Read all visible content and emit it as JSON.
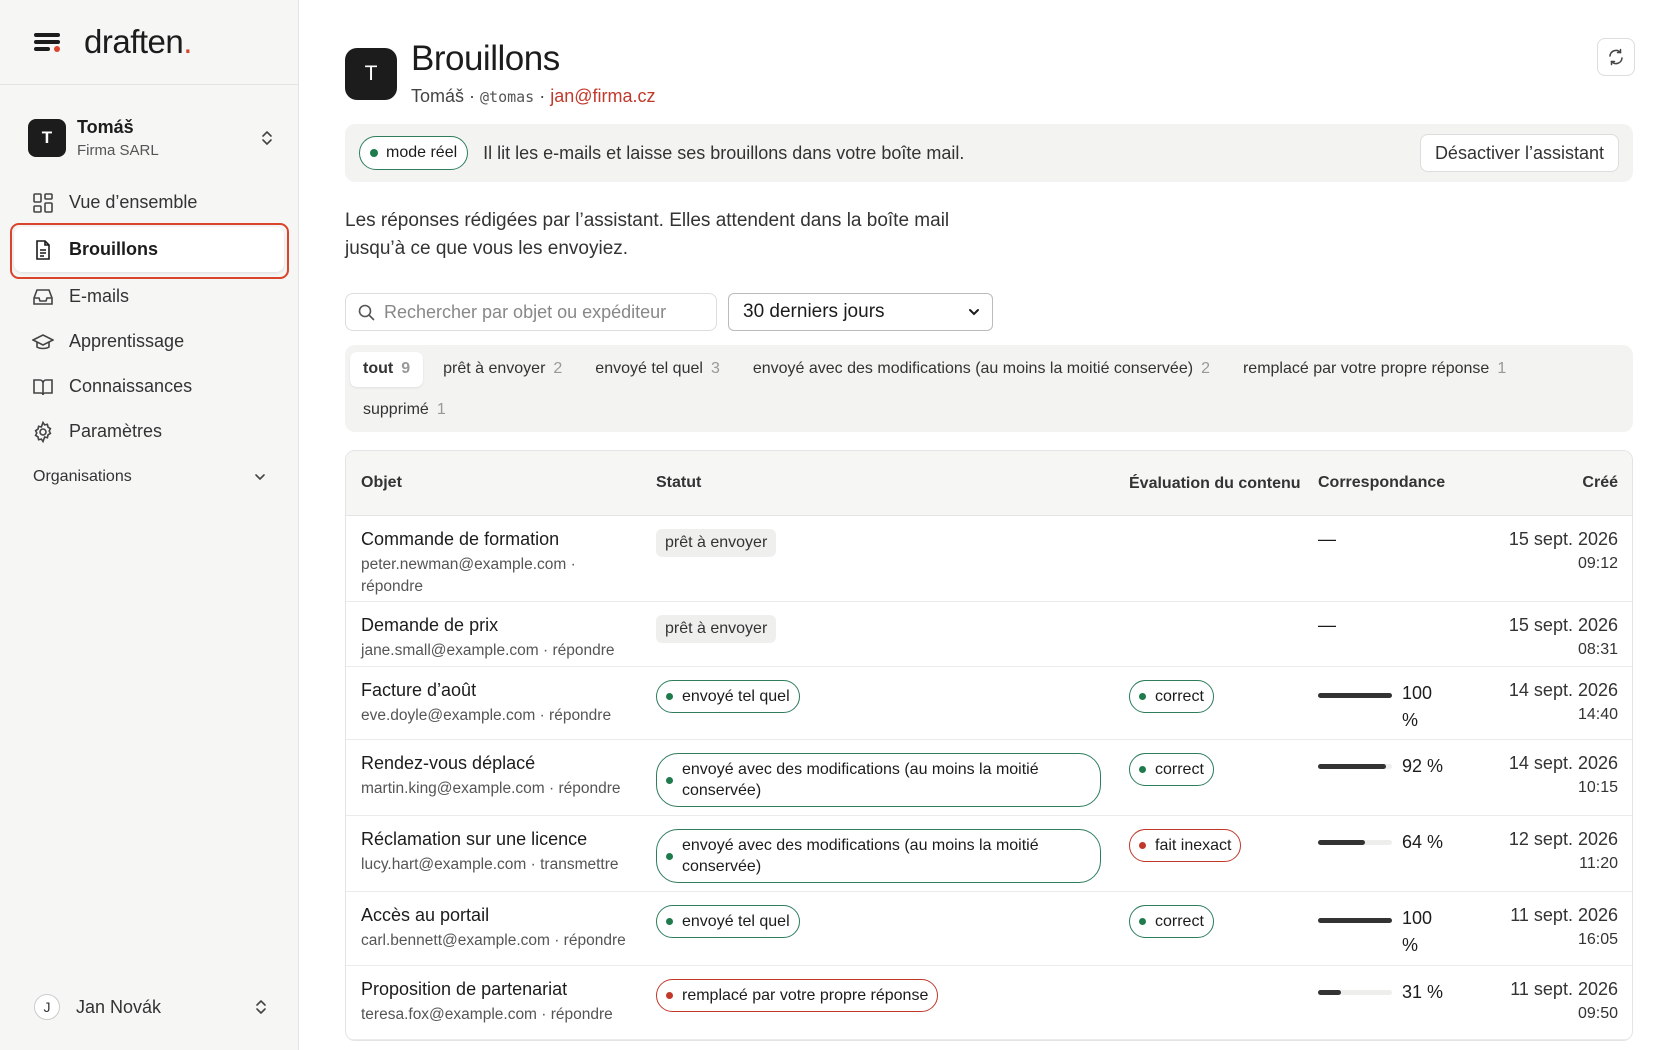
{
  "app": {
    "logo_text": "draften",
    "logo_dot": "."
  },
  "account": {
    "initial": "T",
    "name": "Tomáš",
    "org": "Firma SARL"
  },
  "nav": [
    {
      "label": "Vue d’ensemble",
      "icon": "grid-icon"
    },
    {
      "label": "Brouillons",
      "icon": "document-icon"
    },
    {
      "label": "E-mails",
      "icon": "inbox-icon"
    },
    {
      "label": "Apprentissage",
      "icon": "graduation-cap-icon"
    },
    {
      "label": "Connaissances",
      "icon": "book-icon"
    },
    {
      "label": "Paramètres",
      "icon": "gear-icon"
    }
  ],
  "organisations_label": "Organisations",
  "user": {
    "initial": "J",
    "name": "Jan Novák"
  },
  "header": {
    "initial": "T",
    "title": "Brouillons",
    "name": "Tomáš",
    "handle": "@tomas",
    "email": "jan@firma.cz",
    "sep": " · "
  },
  "banner": {
    "mode": "mode réel",
    "text": "Il lit les e-mails et laisse ses brouillons dans votre boîte mail.",
    "button": "Désactiver l’assistant"
  },
  "description": "Les réponses rédigées par l’assistant. Elles attendent dans la boîte mail jusqu’à ce que vous les envoyiez.",
  "search": {
    "placeholder": "Rechercher par objet ou expéditeur"
  },
  "period": {
    "selected": "30 derniers jours"
  },
  "filters": [
    {
      "label": "tout",
      "count": "9"
    },
    {
      "label": "prêt à envoyer",
      "count": "2"
    },
    {
      "label": "envoyé tel quel",
      "count": "3"
    },
    {
      "label": "envoyé avec des modifications (au moins la moitié conservée)",
      "count": "2"
    },
    {
      "label": "remplacé par votre propre réponse",
      "count": "1"
    },
    {
      "label": "supprimé",
      "count": "1"
    }
  ],
  "table": {
    "headers": [
      "Objet",
      "Statut",
      "Évaluation du contenu",
      "Correspondance",
      "Créé"
    ],
    "rows": [
      {
        "subject": "Commande de formation",
        "meta": "peter.newman@example.com · répondre",
        "status": "prêt à envoyer",
        "status_kind": "gray",
        "eval": "",
        "match": "—",
        "match_fraction": null,
        "date": "15 sept. 2026",
        "time": "09:12"
      },
      {
        "subject": "Demande de prix",
        "meta": "jane.small@example.com · répondre",
        "status": "prêt à envoyer",
        "status_kind": "gray",
        "eval": "",
        "match": "—",
        "match_fraction": null,
        "date": "15 sept. 2026",
        "time": "08:31"
      },
      {
        "subject": "Facture d’août",
        "meta": "eve.doyle@example.com · répondre",
        "status": "envoyé tel quel",
        "status_kind": "green",
        "eval": "correct",
        "eval_kind": "green",
        "match": "100 %",
        "match_fraction": 1.0,
        "date": "14 sept. 2026",
        "time": "14:40"
      },
      {
        "subject": "Rendez-vous déplacé",
        "meta": "martin.king@example.com · répondre",
        "status": "envoyé avec des modifications (au moins la moitié conservée)",
        "status_kind": "green-wide",
        "eval": "correct",
        "eval_kind": "green",
        "match": "92 %",
        "match_fraction": 0.92,
        "date": "14 sept. 2026",
        "time": "10:15"
      },
      {
        "subject": "Réclamation sur une licence",
        "meta": "lucy.hart@example.com · transmettre",
        "status": "envoyé avec des modifications (au moins la moitié conservée)",
        "status_kind": "green-wide",
        "eval": "fait inexact",
        "eval_kind": "red",
        "match": "64 %",
        "match_fraction": 0.64,
        "date": "12 sept. 2026",
        "time": "11:20"
      },
      {
        "subject": "Accès au portail",
        "meta": "carl.bennett@example.com · répondre",
        "status": "envoyé tel quel",
        "status_kind": "green",
        "eval": "correct",
        "eval_kind": "green",
        "match": "100 %",
        "match_fraction": 1.0,
        "date": "11 sept. 2026",
        "time": "16:05"
      },
      {
        "subject": "Proposition de partenariat",
        "meta": "teresa.fox@example.com · répondre",
        "status": "remplacé par votre propre réponse",
        "status_kind": "red",
        "eval": "",
        "match": "31 %",
        "match_fraction": 0.31,
        "date": "11 sept. 2026",
        "time": "09:50"
      }
    ]
  },
  "colors": {
    "accent": "#d9442c",
    "green": "#1f7a4c",
    "red": "#c0392b"
  }
}
